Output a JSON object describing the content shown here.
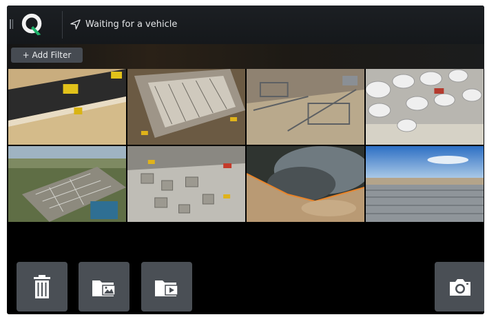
{
  "header": {
    "status_text": "Waiting for a vehicle",
    "status_icon": "navigation-arrow-icon",
    "logo_icon": "q-logo-icon"
  },
  "filters": {
    "add_filter_label": "+ Add Filter"
  },
  "gallery": {
    "items": [
      {
        "subject": "road-paving",
        "icon": "photo-thumbnail"
      },
      {
        "subject": "building-construction",
        "icon": "photo-thumbnail"
      },
      {
        "subject": "industrial-site",
        "icon": "photo-thumbnail"
      },
      {
        "subject": "storage-tanks",
        "icon": "photo-thumbnail"
      },
      {
        "subject": "electrical-substation",
        "icon": "photo-thumbnail"
      },
      {
        "subject": "construction-site",
        "icon": "photo-thumbnail"
      },
      {
        "subject": "wildfire",
        "icon": "photo-thumbnail"
      },
      {
        "subject": "solar-farm",
        "icon": "photo-thumbnail"
      }
    ]
  },
  "toolbar": {
    "buttons": [
      "trash-icon",
      "photo-folder-icon",
      "video-folder-icon",
      "camera-icon"
    ]
  },
  "colors": {
    "background": "#000000",
    "topbar": "#1c1f23",
    "button": "#4a4f55",
    "logo_accent": "#1eb36a"
  }
}
